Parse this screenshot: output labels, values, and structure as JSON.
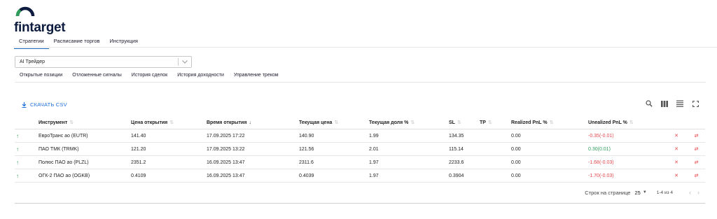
{
  "brand": {
    "logo_text": "fintarget",
    "color": "#0d1b3e",
    "icon": "arc-logo-icon"
  },
  "top_tabs": [
    {
      "label": "Стратегии",
      "active": true
    },
    {
      "label": "Расписание торгов",
      "active": false
    },
    {
      "label": "Инструкция",
      "active": false
    }
  ],
  "strategy_select": {
    "value": "AI Трейдер",
    "icon": "chevron-down-icon"
  },
  "sub_tabs": [
    {
      "label": "Открытые позиции",
      "active": true
    },
    {
      "label": "Отложенные сигналы",
      "active": false
    },
    {
      "label": "История сделок",
      "active": false
    },
    {
      "label": "История доходности",
      "active": false
    },
    {
      "label": "Управление треком",
      "active": false
    }
  ],
  "toolbar": {
    "csv_label": "СКАЧАТЬ CSV",
    "icons": [
      "search-icon",
      "columns-icon",
      "density-icon",
      "fullscreen-icon"
    ]
  },
  "table": {
    "headers": [
      "Инструмент",
      "Цена открытия",
      "Время открытия",
      "Текущая цена",
      "Текущая доля %",
      "SL",
      "TP",
      "Realized PnL %",
      "Unealized PnL %"
    ],
    "rows": [
      {
        "instrument": "ЕвроТранс ао (EUTR)",
        "open_price": "141.40",
        "open_time": "17.09.2025 17:22",
        "current_price": "140.90",
        "share": "1.99",
        "sl": "134.35",
        "tp": "",
        "realized": "0.00",
        "unrealized": "-0.35(-0.01)"
      },
      {
        "instrument": "ПАО ТМК (TRMK)",
        "open_price": "121.20",
        "open_time": "17.09.2025 13:22",
        "current_price": "121.56",
        "share": "2.01",
        "sl": "115.14",
        "tp": "",
        "realized": "0.00",
        "unrealized": "0.30(0.01)"
      },
      {
        "instrument": "Полюс ПАО ао (PLZL)",
        "open_price": "2351.2",
        "open_time": "16.09.2025 13:47",
        "current_price": "2311.6",
        "share": "1.97",
        "sl": "2233.6",
        "tp": "",
        "realized": "0.00",
        "unrealized": "-1.68(-0.03)"
      },
      {
        "instrument": "ОГК-2 ПАО ао (OGKB)",
        "open_price": "0.4109",
        "open_time": "16.09.2025 13:47",
        "current_price": "0.4039",
        "share": "1.97",
        "sl": "0.3904",
        "tp": "",
        "realized": "0.00",
        "unrealized": "-1.70(-0.03)"
      }
    ]
  },
  "pagination": {
    "rows_label": "Строк на странице",
    "rows_value": "25",
    "range": "1-4 из 4"
  },
  "colors": {
    "accent": "#1e6fd9",
    "negative": "#e5484d",
    "positive": "#2e9e5a"
  }
}
